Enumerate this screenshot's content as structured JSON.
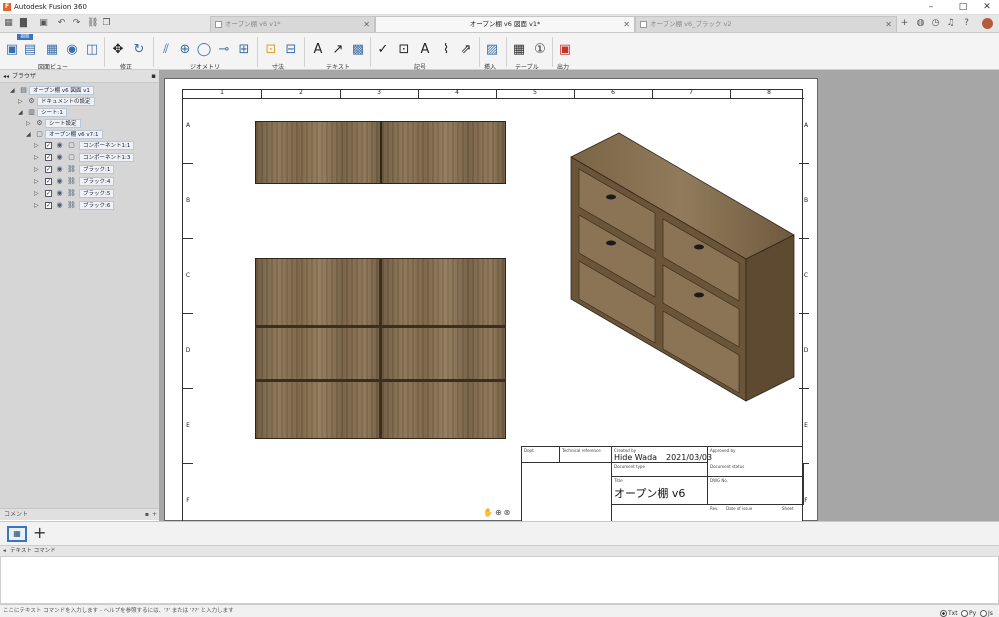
{
  "app": {
    "title": "Autodesk Fusion 360"
  },
  "tabs": [
    {
      "label": "オープン棚 v6 v1*"
    },
    {
      "label": "オープン棚 v6 図面 v1*"
    },
    {
      "label": "オープン棚 v6_ブラック v2"
    }
  ],
  "toolbar": {
    "mode_badge": "図面",
    "groups": [
      "図面ビュー",
      "修正",
      "ジオメトリ",
      "寸法",
      "テキスト",
      "記号",
      "挿入",
      "テーブル",
      "出力"
    ]
  },
  "browser": {
    "title": "ブラウザ",
    "nodes": [
      {
        "label": "オープン棚 v6 図面 v1"
      },
      {
        "label": "ドキュメントの設定"
      },
      {
        "label": "シート:1"
      },
      {
        "label": "シート設定"
      },
      {
        "label": "オープン棚 v6 v7:1"
      },
      {
        "label": "コンポーネント1:1"
      },
      {
        "label": "コンポーネント1:3"
      },
      {
        "label": "ブラック:1"
      },
      {
        "label": "ブラック:4"
      },
      {
        "label": "ブラック:5"
      },
      {
        "label": "ブラック:6"
      }
    ]
  },
  "comments": {
    "label": "コメント"
  },
  "sheet": {
    "columns": [
      "1",
      "2",
      "3",
      "4",
      "5",
      "6",
      "7",
      "8"
    ],
    "rows": [
      "A",
      "B",
      "C",
      "D",
      "E",
      "F"
    ]
  },
  "titleblock": {
    "dept_label": "Dept.",
    "techref_label": "Technical reference",
    "createdby_label": "Created by",
    "approvedby_label": "Approved by",
    "creator": "Hide Wada",
    "date": "2021/03/03",
    "doctype_label": "Document type",
    "docstatus_label": "Document status",
    "title_label": "Title",
    "title": "オープン棚 v6",
    "dwg_label": "DWG No.",
    "rev_label": "Rev.",
    "issue_label": "Date of issue",
    "sheet_label": "Sheet"
  },
  "textcommand": {
    "header": "テキスト コマンド",
    "status": "ここにテキスト コマンドを入力します - ヘルプを参照するには、'?' または '??' と入力します",
    "opt_txt": "Txt",
    "opt_py": "Py",
    "opt_js": "Js"
  },
  "colors": {
    "accent": "#3b73c0",
    "wood": "#7f6a4c",
    "canvas_bg": "#a6a6a6"
  }
}
